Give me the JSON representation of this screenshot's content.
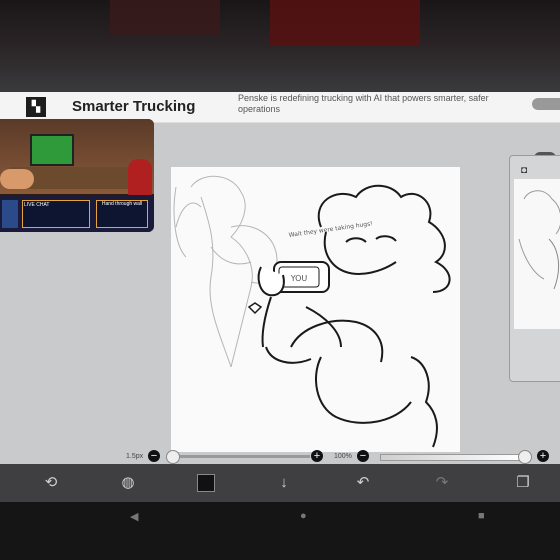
{
  "ad": {
    "title": "Smarter Trucking",
    "description": "Penske is redefining trucking with AI that powers smarter, safer operations"
  },
  "stream": {
    "chat_label": "LIVE CHAT",
    "side_label": "Hand through wall"
  },
  "drawing": {
    "phone_text": "YOU",
    "annotation": "Wait they were taking hugs!"
  },
  "sliders": {
    "size_value": "1.5px",
    "opacity_value": "100%"
  },
  "icons": {
    "ad_logo": "brand-logo-icon",
    "layer_camera": "camera-icon",
    "transform": "transform-icon",
    "brush": "brush-icon",
    "download": "download-icon",
    "undo": "undo-icon",
    "redo": "redo-icon",
    "layers": "layers-icon",
    "nav_back": "back-icon",
    "nav_home": "home-icon",
    "nav_recent": "recent-apps-icon"
  },
  "colors": {
    "primary_color": "#111111",
    "toolbar_bg": "#3f3f41",
    "workspace_bg": "#c9cacb"
  }
}
